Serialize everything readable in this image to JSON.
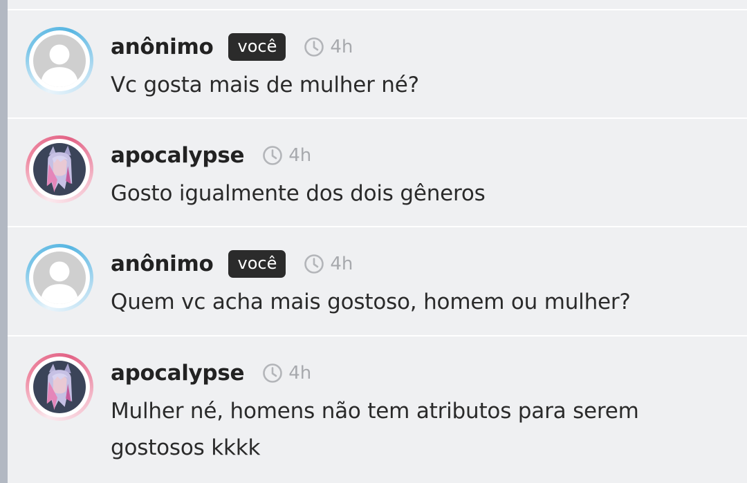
{
  "thread": {
    "comments": [
      {
        "username": "anônimo",
        "badge": "você",
        "time": "4h",
        "text": "Vc gosta mais de mulher né?",
        "avatar": "default-user-avatar",
        "ring_color": "#58b6e2"
      },
      {
        "username": "apocalypse",
        "time": "4h",
        "text": "Gosto igualmente dos dois gêneros",
        "avatar": "anime-character-avatar",
        "ring_color": "#e26386"
      },
      {
        "username": "anônimo",
        "badge": "você",
        "time": "4h",
        "text": "Quem vc acha mais gostoso, homem ou mulher?",
        "avatar": "default-user-avatar",
        "ring_color": "#58b6e2"
      },
      {
        "username": "apocalypse",
        "time": "4h",
        "text": "Mulher né, homens não tem atributos para serem gostosos kkkk",
        "avatar": "anime-character-avatar",
        "ring_color": "#e26386"
      }
    ]
  },
  "icons": {
    "time": "clock-icon"
  },
  "colors": {
    "background": "#eff0f2",
    "badge_bg": "#2b2b2b",
    "timestamp": "#a7a9ad",
    "left_bar": "#b2b8c2"
  }
}
